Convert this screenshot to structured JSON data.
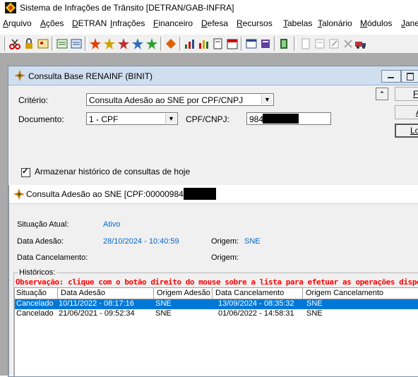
{
  "app": {
    "title": "Sistema de Infrações de Trânsito [DETRAN/GAB-INFRA]"
  },
  "menu": [
    "Arquivo",
    "Ações",
    "DETRAN",
    "Infrações",
    "Financeiro",
    "Defesa",
    "Recursos",
    "Tabelas",
    "Talonário",
    "Módulos",
    "Jane"
  ],
  "child_window": {
    "title": "Consulta Base RENAINF (BINIT)",
    "criterio_label": "Critério:",
    "criterio_value": "Consulta Adesão ao SNE por CPF/CNPJ",
    "documento_label": "Documento:",
    "documento_value": "1 - CPF",
    "cpf_label": "CPF/CNPJ:",
    "cpf_value": "984",
    "historico_checkbox_label": "Armazenar histórico de consultas de hoje",
    "side_buttons": [
      "Fe",
      "A",
      "Lo"
    ]
  },
  "result_window": {
    "title": "Consulta Adesão ao SNE [CPF:00000984",
    "situacao_label": "Situação Atual:",
    "situacao_value": "Ativo",
    "data_adesao_label": "Data Adesão:",
    "data_adesao_value": "28/10/2024 - 10:40:59",
    "origem_label_1": "Origem:",
    "origem_value_1": "SNE",
    "data_cancel_label": "Data Cancelamento:",
    "origem_label_2": "Origem:",
    "historicos_label": "Históricos:",
    "observacao": "Observação: clique com o botão direito do mouse sobre a lista para efetuar as operações dispon",
    "columns": [
      "Situação",
      "Data Adesão",
      "Origem Adesão",
      "Data Cancelamento",
      "Origem Cancelamento"
    ],
    "rows": [
      {
        "situacao": "Cancelado",
        "data_adesao": "10/11/2022 - 08:17:16",
        "origem_adesao": "SNE",
        "data_cancel": "13/09/2024 - 08:35:32",
        "origem_cancel": "SNE",
        "selected": true
      },
      {
        "situacao": "Cancelado",
        "data_adesao": "21/06/2021 - 09:52:34",
        "origem_adesao": "SNE",
        "data_cancel": "01/06/2022 - 14:58:31",
        "origem_cancel": "SNE",
        "selected": false
      }
    ]
  },
  "colors": {
    "link_blue": "#0066cc",
    "obs_red": "#ff0000",
    "selection": "#0078d7"
  }
}
